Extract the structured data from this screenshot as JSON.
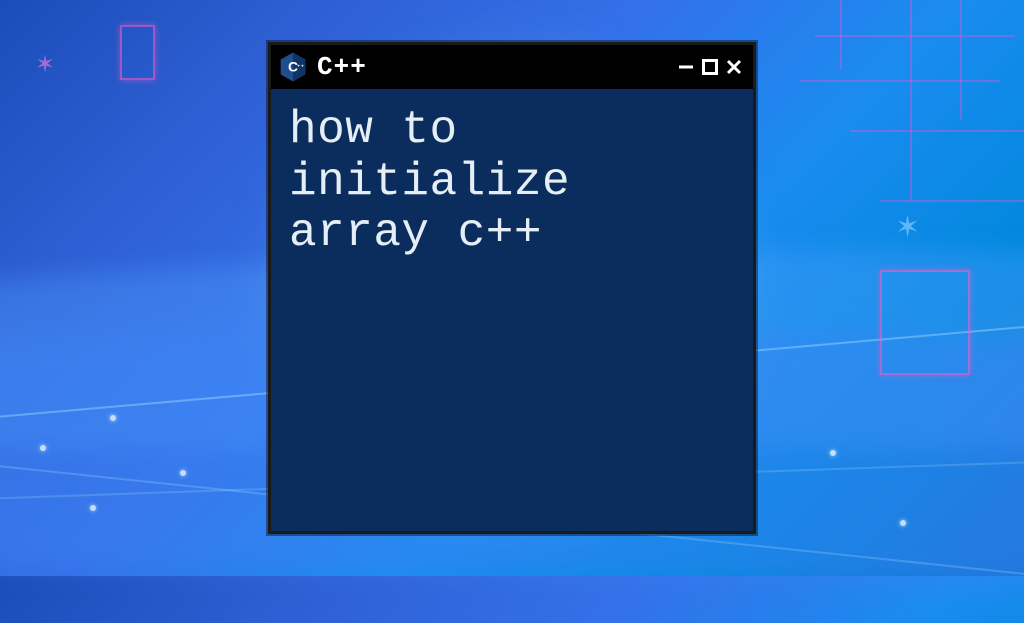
{
  "window": {
    "title": "C++",
    "logo_label": "C++",
    "content_text": "how to\ninitialize\narray c++"
  },
  "icons": {
    "minimize": "minimize-icon",
    "maximize": "maximize-icon",
    "close": "close-icon",
    "cpp": "cpp-logo"
  },
  "colors": {
    "window_bg": "#0b2d5d",
    "titlebar_bg": "#000000",
    "text": "#e6eef5",
    "logo_blue": "#1e4f8c",
    "logo_blue_dark": "#0f3466"
  }
}
